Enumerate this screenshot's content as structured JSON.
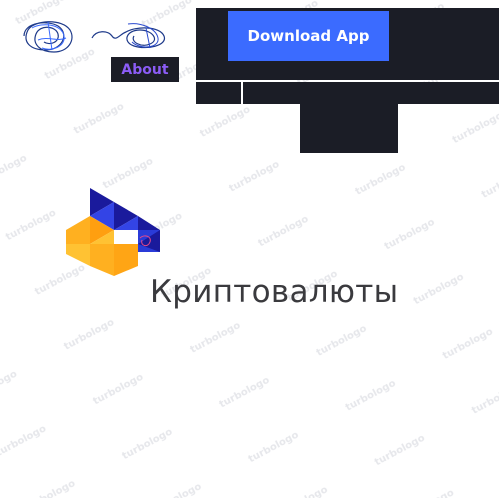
{
  "nav": {
    "about_label": "About",
    "download_label": "Download App"
  },
  "brand": {
    "name": "Криптовалюты",
    "logo_icon": "crypto-cube-logo"
  },
  "watermark": {
    "text": "turbologo"
  },
  "colors": {
    "nav_dark": "#1b1d26",
    "accent_blue": "#3b6bff",
    "about_purple": "#8b5cf6",
    "logo_navy": "#1a1a9c",
    "logo_blue": "#3344e6",
    "logo_yellow": "#ffb020",
    "brand_text": "#3a3a3e",
    "scribble_blue": "#1e3a8a"
  }
}
